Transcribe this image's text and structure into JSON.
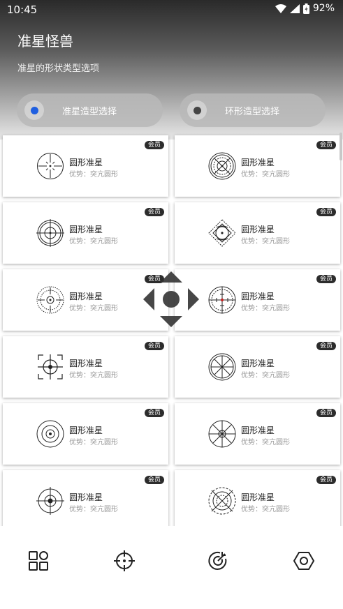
{
  "status_bar": {
    "time": "10:45",
    "battery": "92%"
  },
  "header": {
    "title": "准星怪兽",
    "subtitle": "准星的形状类型选项"
  },
  "mode_buttons": [
    {
      "label": "准星造型选择",
      "selected": true
    },
    {
      "label": "环形造型选择",
      "selected": false
    }
  ],
  "cards": [
    {
      "badge": "会员",
      "title": "圆形准星",
      "desc": "优势：突亢圆形",
      "icon": "crosshair-thin-icon"
    },
    {
      "badge": "会员",
      "title": "圆形准星",
      "desc": "优势：突亢圆形",
      "icon": "crosshair-concentric-icon"
    },
    {
      "badge": "会员",
      "title": "圆形准星",
      "desc": "优势：突亢圆形",
      "icon": "crosshair-rings-icon"
    },
    {
      "badge": "会员",
      "title": "圆形准星",
      "desc": "优势：突亢圆形",
      "icon": "crosshair-diamond-icon"
    },
    {
      "badge": "会员",
      "title": "圆形准星",
      "desc": "优势：突亢圆形",
      "icon": "crosshair-dotted-icon"
    },
    {
      "badge": "会员",
      "title": "圆形准星",
      "desc": "优势：突亢圆形",
      "icon": "crosshair-scope-icon"
    },
    {
      "badge": "会员",
      "title": "圆形准星",
      "desc": "优势：突亢圆形",
      "icon": "crosshair-bracket-icon"
    },
    {
      "badge": "会员",
      "title": "圆形准星",
      "desc": "优势：突亢圆形",
      "icon": "crosshair-spoke-icon"
    },
    {
      "badge": "会员",
      "title": "圆形准星",
      "desc": "优势：突亢圆形",
      "icon": "crosshair-bullseye-icon"
    },
    {
      "badge": "会员",
      "title": "圆形准星",
      "desc": "优势：突亢圆形",
      "icon": "crosshair-star-icon"
    },
    {
      "badge": "会员",
      "title": "圆形准星",
      "desc": "优势：突亢圆形",
      "icon": "crosshair-dot-icon"
    },
    {
      "badge": "会员",
      "title": "圆形准星",
      "desc": "优势：突亢圆形",
      "icon": "crosshair-x-icon"
    }
  ],
  "bottom_nav": [
    {
      "icon": "grid-apps-icon"
    },
    {
      "icon": "crosshair-icon"
    },
    {
      "icon": "target-arrow-icon"
    },
    {
      "icon": "hex-settings-icon"
    }
  ],
  "colors": {
    "selected_dot": "#1f5fe0",
    "badge_bg": "#2c2c2c"
  }
}
